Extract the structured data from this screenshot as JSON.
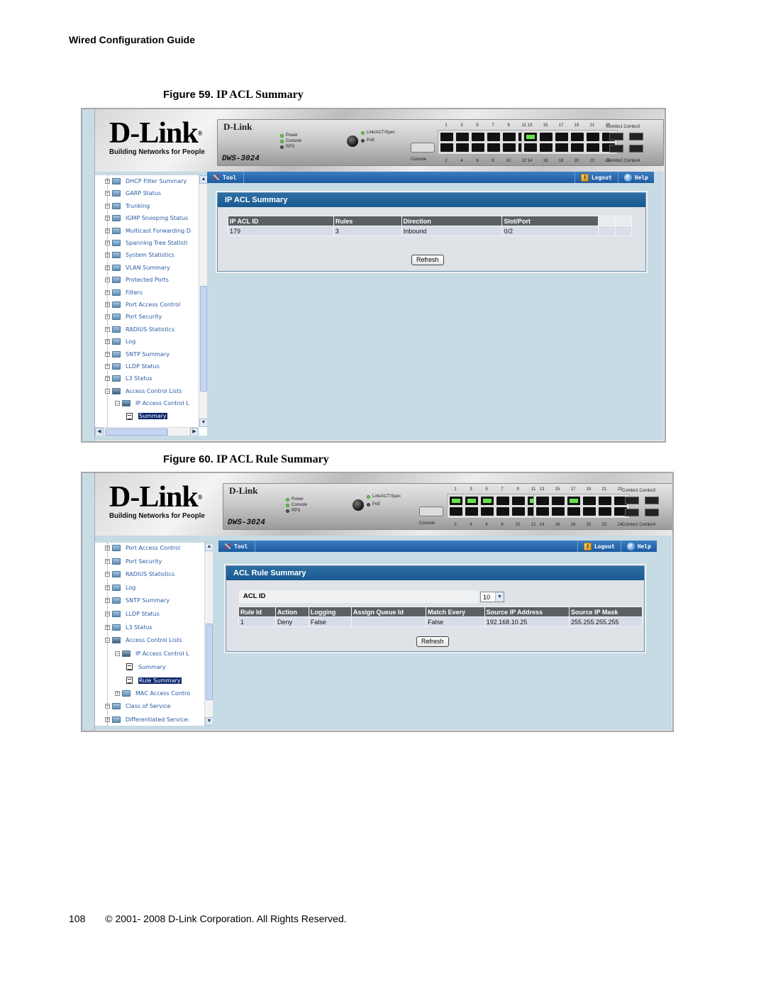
{
  "document": {
    "running_header": "Wired Configuration Guide",
    "page_number": "108",
    "copyright": "© 2001- 2008 D-Link Corporation. All Rights Reserved."
  },
  "common": {
    "logo_text": "D-Link",
    "logo_registered": "®",
    "logo_tagline": "Building Networks for People",
    "device_brand": "D-Link",
    "device_model": "DWS-3024",
    "led_labels": [
      "Power",
      "Console",
      "RPS"
    ],
    "led_labels_right": [
      "Link/ACT/Spec",
      "PoE"
    ],
    "console_label": "Console",
    "ports_top_left": [
      "1",
      "3",
      "5",
      "7",
      "9",
      "11"
    ],
    "ports_bottom_left": [
      "2",
      "4",
      "6",
      "8",
      "10",
      "12"
    ],
    "ports_top_right": [
      "13",
      "15",
      "17",
      "19",
      "21",
      "23"
    ],
    "ports_bottom_right": [
      "14",
      "16",
      "18",
      "20",
      "22",
      "24"
    ],
    "combo_top": "Combo1 Combo3",
    "combo_bottom": "Combo2 Combo4",
    "toolbar": {
      "tool": "Tool",
      "logout": "Logout",
      "help": "Help"
    },
    "colors": {
      "toolbar": "#1c5aa0",
      "panel_title": "#195a90",
      "header_cell": "#5c6063",
      "link_on": "#65e34b",
      "background": "#c6dbe3"
    }
  },
  "figure59": {
    "label": "Figure 59.",
    "title": "IP ACL Summary",
    "active_ports": [
      "13"
    ],
    "tree": [
      {
        "label": "DHCP Filter Summary",
        "type": "folder"
      },
      {
        "label": "GARP Status",
        "type": "folder"
      },
      {
        "label": "Trunking",
        "type": "folder"
      },
      {
        "label": "IGMP Snooping Status",
        "type": "folder"
      },
      {
        "label": "Multicast Forwarding D",
        "type": "folder"
      },
      {
        "label": "Spanning Tree Statisti",
        "type": "folder"
      },
      {
        "label": "System Statistics",
        "type": "folder"
      },
      {
        "label": "VLAN Summary",
        "type": "folder"
      },
      {
        "label": "Protected Ports",
        "type": "folder"
      },
      {
        "label": "Filters",
        "type": "folder"
      },
      {
        "label": "Port Access Control",
        "type": "folder"
      },
      {
        "label": "Port Security",
        "type": "folder"
      },
      {
        "label": "RADIUS Statistics",
        "type": "folder"
      },
      {
        "label": "Log",
        "type": "folder"
      },
      {
        "label": "SNTP Summary",
        "type": "folder"
      },
      {
        "label": "LLDP Status",
        "type": "folder"
      },
      {
        "label": "L3 Status",
        "type": "folder"
      },
      {
        "label": "Access Control Lists",
        "type": "open"
      },
      {
        "label": "IP Access Control L",
        "type": "open-sub"
      },
      {
        "label": "Summary",
        "type": "page-selected"
      }
    ],
    "panel": {
      "title": "IP ACL Summary",
      "columns": [
        "IP ACL ID",
        "Rules",
        "Direction",
        "Slot/Port"
      ],
      "rows": [
        [
          "179",
          "3",
          "Inbound",
          "0/2"
        ]
      ],
      "refresh_label": "Refresh"
    }
  },
  "figure60": {
    "label": "Figure 60.",
    "title": "IP ACL Rule Summary",
    "active_ports": [
      "1",
      "3",
      "5",
      "11",
      "17"
    ],
    "tree": [
      {
        "label": "Port Access Control",
        "type": "folder"
      },
      {
        "label": "Port Security",
        "type": "folder"
      },
      {
        "label": "RADIUS Statistics",
        "type": "folder"
      },
      {
        "label": "Log",
        "type": "folder"
      },
      {
        "label": "SNTP Summary",
        "type": "folder"
      },
      {
        "label": "LLDP Status",
        "type": "folder"
      },
      {
        "label": "L3 Status",
        "type": "folder"
      },
      {
        "label": "Access Control Lists",
        "type": "open"
      },
      {
        "label": "IP Access Control L",
        "type": "open-sub"
      },
      {
        "label": "Summary",
        "type": "page"
      },
      {
        "label": "Rule Summary",
        "type": "page-selected"
      },
      {
        "label": "MAC Access Contro",
        "type": "folder-sub"
      },
      {
        "label": "Class of Service",
        "type": "folder"
      },
      {
        "label": "Differentiated Service:",
        "type": "folder"
      }
    ],
    "panel": {
      "title": "ACL Rule Summary",
      "acl_id_label": "ACL ID",
      "acl_id_value": "10",
      "columns": [
        "Rule Id",
        "Action",
        "Logging",
        "Assign Queue Id",
        "Match Every",
        "Source IP Address",
        "Source IP Mask"
      ],
      "rows": [
        [
          "1",
          "Deny",
          "False",
          "",
          "False",
          "192.168.10.25",
          "255.255.255.255"
        ]
      ],
      "refresh_label": "Refresh"
    }
  }
}
